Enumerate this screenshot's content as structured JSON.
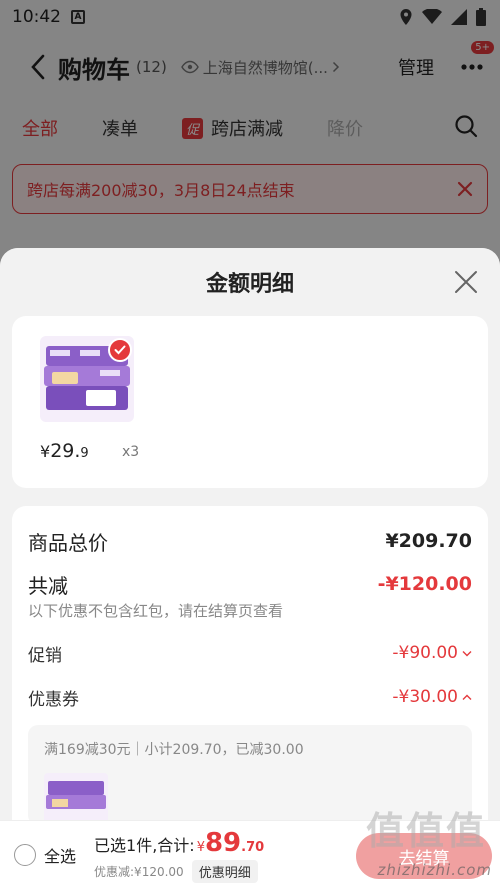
{
  "status_bar": {
    "time": "10:42",
    "app_letter": "A"
  },
  "header": {
    "title": "购物车",
    "count": "(12)",
    "location": "上海自然博物馆(...",
    "manage": "管理",
    "badge": "5+"
  },
  "tabs": [
    {
      "label": "全部"
    },
    {
      "label": "凑单"
    },
    {
      "label": "跨店满减",
      "tag": "促"
    },
    {
      "label": "降价"
    }
  ],
  "promo_banner": {
    "text": "跨店每满200减30，3月8日24点结束"
  },
  "sheet": {
    "title": "金额明细",
    "product": {
      "price_symbol": "¥",
      "price_int": "29.",
      "price_dec": "9",
      "quantity": "x3"
    },
    "details": {
      "total_label": "商品总价",
      "total_value": "¥209.70",
      "reduce_label": "共减",
      "reduce_value": "-¥120.00",
      "reduce_note": "以下优惠不包含红包，请在结算页查看",
      "promo_label": "促销",
      "promo_value": "-¥90.00",
      "coupon_label": "优惠券",
      "coupon_value": "-¥30.00",
      "coupon_detail": "满169减30元｜小计209.70，已减30.00"
    }
  },
  "bottom_bar": {
    "select_all": "全选",
    "selected_text": "已选1件,合计:",
    "total_symbol": "¥",
    "total_int": "89",
    "total_dec": ".70",
    "discount_text": "优惠减:¥120.00",
    "detail_button": "优惠明细",
    "checkout_button": "去结算"
  },
  "watermark": {
    "logo": "值值值",
    "url": "zhizhizhi.com"
  },
  "colors": {
    "accent": "#e4393c",
    "sheet_bg": "#f2f2f2",
    "checkout_bg": "#f0a0a0"
  }
}
